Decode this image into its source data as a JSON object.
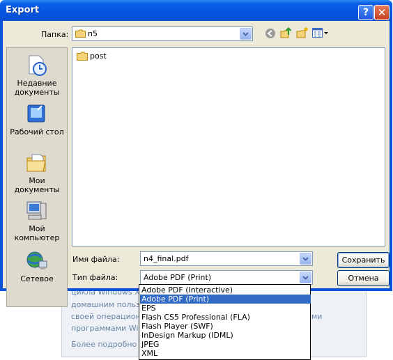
{
  "window": {
    "title": "Export",
    "help_glyph": "?",
    "close_glyph": "✕"
  },
  "lookin": {
    "label": "Папка:",
    "value": "n5"
  },
  "places": [
    {
      "name": "recent",
      "label_lines": [
        "Недавние",
        "документы"
      ]
    },
    {
      "name": "desktop",
      "label_lines": [
        "Рабочий стол"
      ]
    },
    {
      "name": "my-documents",
      "label_lines": [
        "Мои документы"
      ]
    },
    {
      "name": "my-computer",
      "label_lines": [
        "Мой",
        "компьютер"
      ]
    },
    {
      "name": "network",
      "label_lines": [
        "Сетевое"
      ]
    }
  ],
  "files": [
    {
      "name": "post",
      "type": "folder"
    }
  ],
  "filename": {
    "label": "Имя файла:",
    "value": "n4_final.pdf"
  },
  "filetype": {
    "label": "Тип файла:",
    "value": "Adobe PDF (Print)",
    "options": [
      "Adobe PDF (Interactive)",
      "Adobe PDF (Print)",
      "EPS",
      "Flash CS5 Professional (FLA)",
      "Flash Player (SWF)",
      "InDesign Markup (IDML)",
      "JPEG",
      "XML"
    ],
    "selected_index": 1
  },
  "buttons": {
    "save": "Сохранить",
    "cancel": "Отмена"
  },
  "background_page": {
    "lines": [
      "цикла Windows XP",
      "домашним пользов",
      "своей операционн",
      "программами Winc",
      "Более подробно см"
    ],
    "right_fragments": [
      "ми"
    ]
  },
  "colors": {
    "title_blue": "#0a53d8",
    "selection": "#316ac5",
    "dialog_face": "#ece9d8"
  }
}
